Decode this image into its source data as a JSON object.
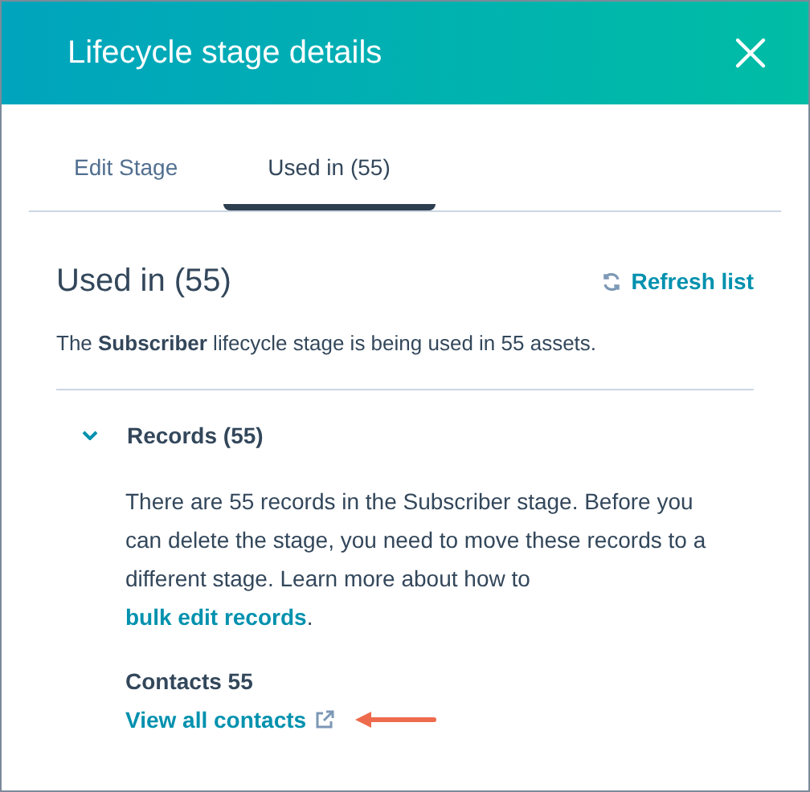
{
  "header": {
    "title": "Lifecycle stage details"
  },
  "tabs": [
    {
      "label": "Edit Stage",
      "selected": false
    },
    {
      "label": "Used in (55)",
      "selected": true
    }
  ],
  "section": {
    "title": "Used in (55)",
    "refresh": "Refresh list",
    "summary": "The **Subscriber** lifecycle stage is being used in 55 assets."
  },
  "records": {
    "label": "Records (55)",
    "expanded": true,
    "text": "There are 55 records in the Subscriber stage. Before you can delete the stage, you need to move these records to a different stage. Learn more about how to",
    "link": "bulk edit records",
    "after": ".",
    "contacts_title": "Contacts 55",
    "contacts_link": "View all contacts"
  }
}
